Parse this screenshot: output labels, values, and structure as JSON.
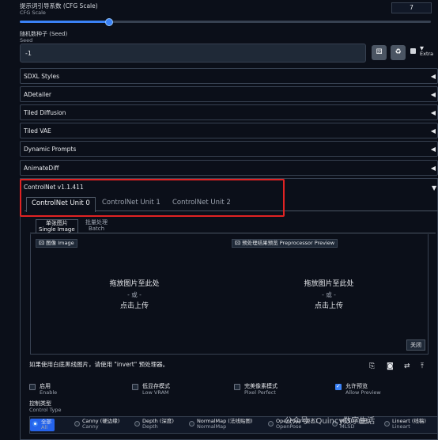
{
  "cfg": {
    "title": "提示词引导系数 (CFG Scale)",
    "subtitle": "CFG Scale",
    "value": "7",
    "slider_fraction": 0.21
  },
  "seed": {
    "title": "随机数种子 (Seed)",
    "subtitle": "Seed",
    "value": "-1",
    "extra_label": "Extra",
    "buttons": [
      "dice-icon",
      "recycle-icon"
    ]
  },
  "accordions": [
    {
      "label": "SDXL Styles"
    },
    {
      "label": "ADetailer"
    },
    {
      "label": "Tiled Diffusion"
    },
    {
      "label": "Tiled VAE"
    },
    {
      "label": "Dynamic Prompts"
    },
    {
      "label": "AnimateDiff"
    }
  ],
  "controlnet": {
    "title": "ControlNet v1.1.411",
    "tabs": [
      "ControlNet Unit 0",
      "ControlNet Unit 1",
      "ControlNet Unit 2"
    ],
    "inner_tabs": [
      {
        "label": "单张图片",
        "sub": "Single Image"
      },
      {
        "label": "批量处理",
        "sub": "Batch"
      }
    ],
    "image_tag": {
      "label": "图像",
      "sub": "Image"
    },
    "preview_tag": {
      "label": "预处理结果预览",
      "sub": "Preprocessor Preview"
    },
    "drop": {
      "line1": "拖放图片至此处",
      "or": "- 或 -",
      "line2": "点击上传"
    },
    "close_label": "关闭",
    "invert_note": "如果使用白底黑线图片，请使用 \"invert\" 预处理器。",
    "checkboxes": [
      {
        "label": "启用",
        "sub": "Enable",
        "checked": false
      },
      {
        "label": "低显存模式",
        "sub": "Low VRAM",
        "checked": false
      },
      {
        "label": "完美像素模式",
        "sub": "Pixel Perfect",
        "checked": false
      },
      {
        "label": "允许预览",
        "sub": "Allow Preview",
        "checked": true
      }
    ],
    "control_type": {
      "title": "控制类型",
      "sub": "Control Type"
    },
    "control_options": [
      {
        "label": "全部",
        "sub": "All",
        "selected": true
      },
      {
        "label": "Canny (硬边缘)",
        "sub": "Canny"
      },
      {
        "label": "Depth (深度)",
        "sub": "Depth"
      },
      {
        "label": "NormalMap (法线贴图)",
        "sub": "NormalMap"
      },
      {
        "label": "OpenPose (姿态)",
        "sub": "OpenPose"
      },
      {
        "label": "MLSD (直线)",
        "sub": "MLSD"
      },
      {
        "label": "Lineart (线稿)",
        "sub": "Lineart"
      }
    ]
  },
  "watermark": "公众号 · Quincy数字生活",
  "colors": {
    "accent": "#3b82f6",
    "highlight_box": "#e02323",
    "background": "#0b0f19"
  }
}
